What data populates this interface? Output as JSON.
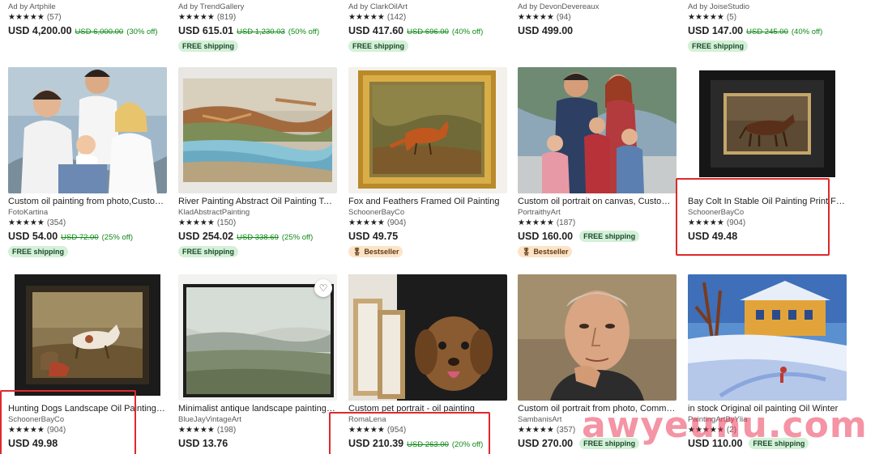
{
  "row_top": [
    {
      "title": "Ad by Artphile",
      "rating": "★★★★★",
      "reviews": "(57)",
      "price": "USD 4,200.00",
      "orig": "USD 6,000.00",
      "off": "(30% off)",
      "badge": ""
    },
    {
      "title": "Ad by TrendGallery",
      "rating": "★★★★★",
      "reviews": "(819)",
      "price": "USD 615.01",
      "orig": "USD 1,230.03",
      "off": "(50% off)",
      "badge": "FREE shipping"
    },
    {
      "title": "Ad by ClarkOilArt",
      "rating": "★★★★★",
      "reviews": "(142)",
      "price": "USD 417.60",
      "orig": "USD 696.00",
      "off": "(40% off)",
      "badge": "FREE shipping"
    },
    {
      "title": "Ad by DevonDevereaux",
      "rating": "★★★★★",
      "reviews": "(94)",
      "price": "USD 499.00",
      "orig": "",
      "off": "",
      "badge": ""
    },
    {
      "title": "Ad by JoiseStudio",
      "rating": "★★★★★",
      "reviews": "(5)",
      "price": "USD 147.00",
      "orig": "USD 245.00",
      "off": "(40% off)",
      "badge": "FREE shipping"
    }
  ],
  "row_mid": [
    {
      "title": "Custom oil painting from photo,Custom portrait",
      "shop": "FotoKartina",
      "rating": "★★★★★",
      "reviews": "(354)",
      "price": "USD 54.00",
      "orig": "USD 72.00",
      "off": "(25% off)",
      "badge": "FREE shipping",
      "image": "family-portrait-painting"
    },
    {
      "title": "River Painting Abstract Oil Painting Texture",
      "shop": "KladAbstractPainting",
      "rating": "★★★★★",
      "reviews": "(150)",
      "price": "USD 254.02",
      "orig": "USD 338.69",
      "off": "(25% off)",
      "badge": "FREE shipping",
      "image": "abstract-river-painting"
    },
    {
      "title": "Fox and Feathers Framed Oil Painting",
      "shop": "SchoonerBayCo",
      "rating": "★★★★★",
      "reviews": "(904)",
      "price": "USD 49.75",
      "orig": "",
      "off": "",
      "bestseller": "Bestseller",
      "image": "framed-fox-painting"
    },
    {
      "title": "Custom oil portrait on canvas, Custom family",
      "shop": "PortraithyArt",
      "rating": "★★★★★",
      "reviews": "(187)",
      "price": "USD 160.00",
      "orig": "",
      "off": "",
      "inline_badge": "FREE shipping",
      "bestseller": "Bestseller",
      "image": "family-portrait-photo"
    },
    {
      "title": "Bay Colt In Stable Oil Painting Print Framed",
      "shop": "SchoonerBayCo",
      "rating": "★★★★★",
      "reviews": "(904)",
      "price": "USD 49.48",
      "orig": "",
      "off": "",
      "image": "framed-horse-painting"
    }
  ],
  "row_bottom": [
    {
      "title": "Hunting Dogs Landscape Oil Painting Framed",
      "shop": "SchoonerBayCo",
      "rating": "★★★★★",
      "reviews": "(904)",
      "price": "USD 49.98",
      "orig": "",
      "off": "",
      "image": "framed-hunting-dogs-painting"
    },
    {
      "title": "Minimalist antique landscape painting print",
      "shop": "BlueJayVintageArt",
      "rating": "★★★★★",
      "reviews": "(198)",
      "price": "USD 13.76",
      "orig": "",
      "off": "",
      "image": "landscape-canvas-print",
      "favorite": "♡"
    },
    {
      "title": "Custom pet portrait - oil painting",
      "shop": "RomaLena",
      "rating": "★★★★★",
      "reviews": "(954)",
      "price": "USD 210.39",
      "orig": "USD 263.00",
      "off": "(20% off)",
      "image": "dog-portrait-canvases"
    },
    {
      "title": "Custom oil portrait from photo, Commission",
      "shop": "SambanisArt",
      "rating": "★★★★★",
      "reviews": "(357)",
      "price": "USD 270.00",
      "orig": "",
      "off": "",
      "inline_badge": "FREE shipping",
      "image": "man-oil-portrait"
    },
    {
      "title": "in stock Original oil painting Oil Winter",
      "shop": "PaintingArtByYlia",
      "rating": "★★★★★",
      "reviews": "(2)",
      "price": "USD 110.00",
      "orig": "",
      "off": "",
      "inline_badge": "FREE shipping",
      "image": "winter-village-painting"
    }
  ],
  "watermark": "awyeunu.com",
  "colors": {
    "highlight": "#e0282c",
    "discount": "#0e8a16",
    "free_shipping_bg": "#d4f0d8",
    "bestseller_bg": "#fde4c8"
  }
}
